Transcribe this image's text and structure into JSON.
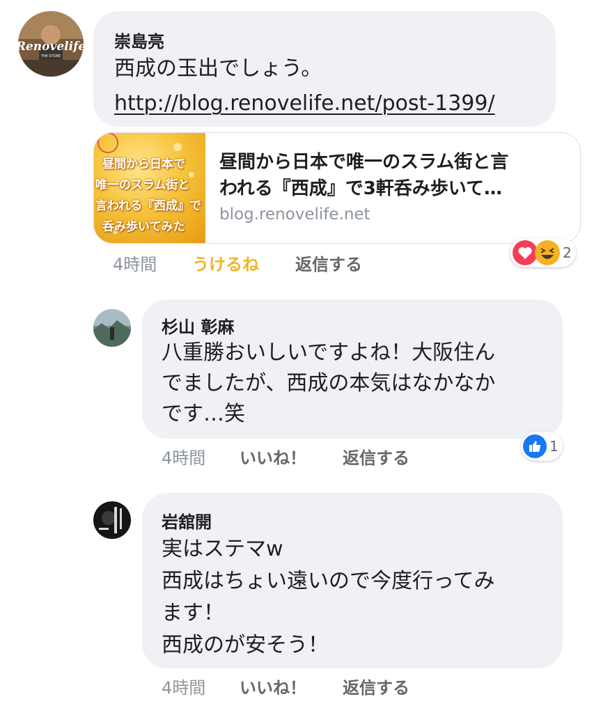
{
  "colors": {
    "bubble": "#f0f1f4",
    "reacted_action": "#f0b526",
    "meta": "#65676b",
    "like_blue": "#1877f2",
    "love_red": "#f33e58",
    "haha_yellow": "#f7b125"
  },
  "comments": [
    {
      "author": "崇島亮",
      "avatar_label": "Renovelife",
      "avatar_sub": "THE STORE",
      "lines": [
        "西成の玉出でしょう。"
      ],
      "link": "http://blog.renovelife.net/post-1399/",
      "preview": {
        "thumb_lines": [
          "昼間から日本で",
          "唯一のスラム街と",
          "言われる『西成』で",
          "呑み歩いてみた"
        ],
        "title_lines": [
          "昼間から日本で唯一のスラム街と言",
          "われる『西成』で3軒呑み歩いて…"
        ],
        "domain": "blog.renovelife.net"
      },
      "time": "4時間",
      "react_label": "うけるね",
      "reply_label": "返信する",
      "reaction_icons": [
        "love-icon",
        "haha-icon"
      ],
      "reaction_count": "2"
    },
    {
      "author": "杉山 彰麻",
      "lines": [
        "八重勝おいしいですよね！大阪住ん",
        "でましたが、西成の本気はなかなか",
        "です…笑"
      ],
      "time": "4時間",
      "react_label": "いいね！",
      "reply_label": "返信する",
      "reaction_icons": [
        "like-icon"
      ],
      "reaction_count": "1"
    },
    {
      "author": "岩舘開",
      "lines": [
        "実はステマw",
        "西成はちょい遠いので今度行ってみ",
        "ます！",
        "西成のが安そう！"
      ],
      "time": "4時間",
      "react_label": "いいね！",
      "reply_label": "返信する"
    }
  ]
}
